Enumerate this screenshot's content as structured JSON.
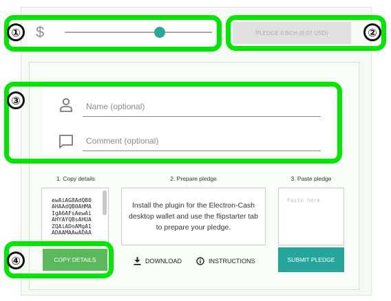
{
  "amount": {
    "currency_icon": "dollar-icon",
    "currency_symbol": "$",
    "slider_level_percent": 65
  },
  "pledge_button": {
    "label": "PLEDGE 0 BCH (0.07 USD)"
  },
  "form": {
    "name_placeholder": "Name (optional)",
    "comment_placeholder": "Comment (optional)",
    "name_icon": "person-icon",
    "comment_icon": "comment-icon"
  },
  "steps": {
    "copy": {
      "title": "1. Copy details",
      "text": "ewAiAG8AdQB0\nAHAAdQB0AHMA\nIgA6AFsAewAi\nAHYAYQBsAHUA\nZQAiADoAMgA1\nADAAMAAwADAA",
      "button_label": "COPY DETAILS"
    },
    "prepare": {
      "title": "2. Prepare pledge",
      "text": "Install the plugin for the Electron-Cash desktop wallet and use the flipstarter tab to prepare your pledge.",
      "download_label": "DOWNLOAD",
      "instructions_label": "INSTRUCTIONS"
    },
    "paste": {
      "title": "3. Paste pledge",
      "placeholder": "Paste here",
      "button_label": "SUBMIT PLEDGE"
    }
  },
  "annotations": [
    "①",
    "②",
    "③",
    "④"
  ],
  "colors": {
    "highlight": "#00e600",
    "teal": "#26a69a",
    "green": "#5cb85c"
  }
}
